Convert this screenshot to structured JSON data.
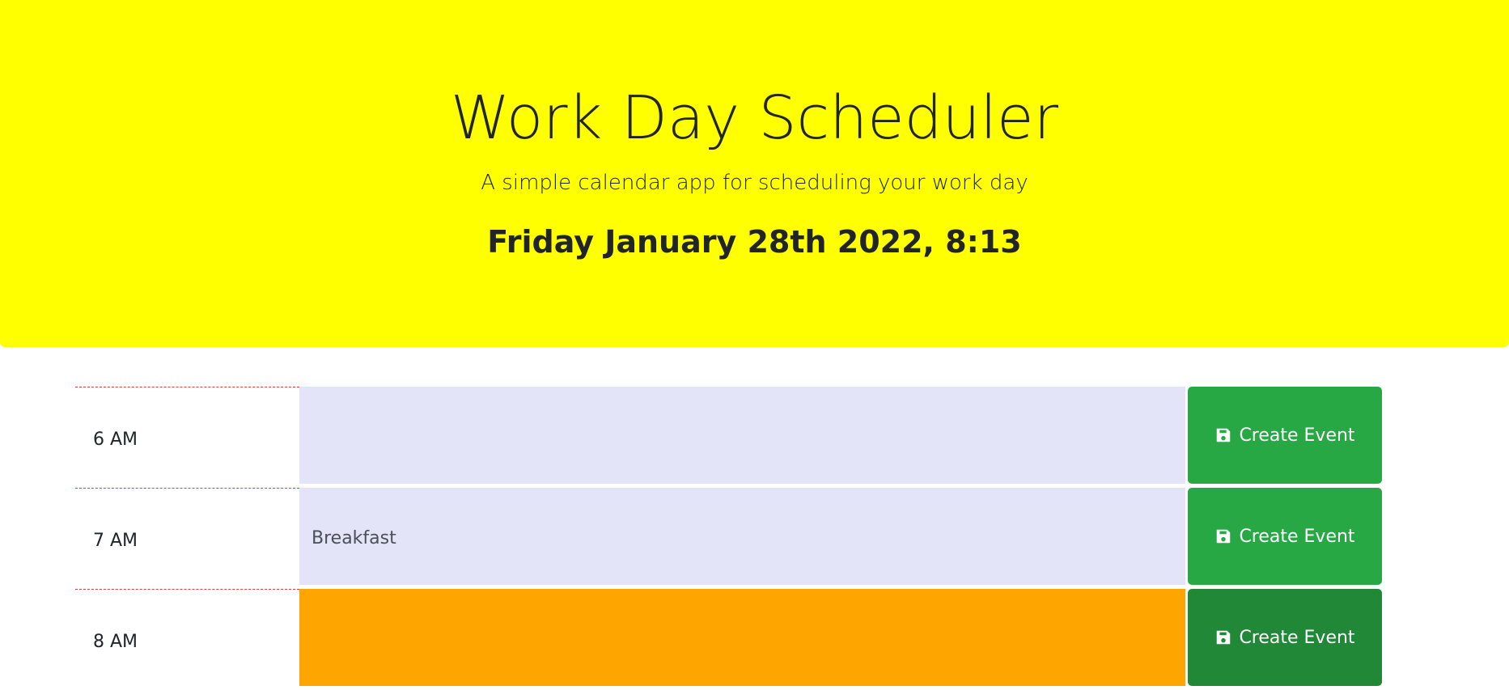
{
  "header": {
    "title": "Work Day Scheduler",
    "subtitle": "A simple calendar app for scheduling your work day",
    "current_day": "Friday January 28th 2022, 8:13",
    "background_color": "#ffff00"
  },
  "schedule": {
    "button_label": "Create Event",
    "button_icon": "floppy-disk-icon",
    "colors": {
      "past": "#e4e4f8",
      "present": "#ffa500",
      "button": "#28a745",
      "button_active": "#218838"
    },
    "rows": [
      {
        "hour": "6 AM",
        "event": "",
        "state": "past"
      },
      {
        "hour": "7 AM",
        "event": "Breakfast",
        "state": "past"
      },
      {
        "hour": "8 AM",
        "event": "",
        "state": "present"
      }
    ]
  }
}
